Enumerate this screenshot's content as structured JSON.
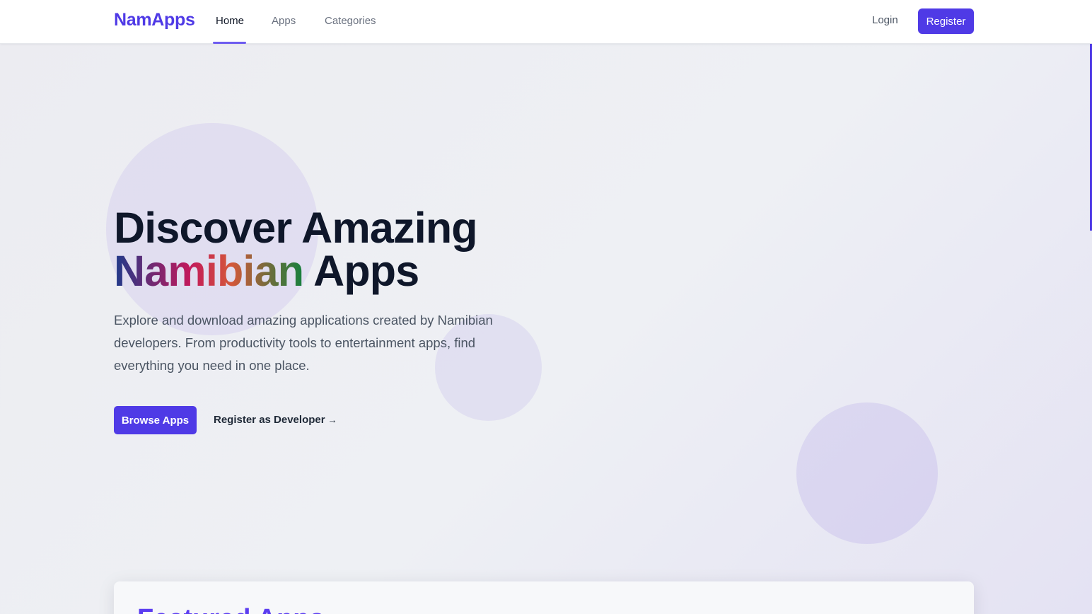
{
  "header": {
    "logo": "NamApps",
    "nav": {
      "home": "Home",
      "apps": "Apps",
      "categories": "Categories"
    },
    "active_nav": "Home",
    "login": "Login",
    "register": "Register"
  },
  "hero": {
    "title_line1": "Discover Amazing",
    "title_highlight": "Namibian",
    "title_rest": "Apps",
    "description": "Explore and download amazing applications created by Namibian developers. From productivity tools to entertainment apps, find everything you need in one place.",
    "browse_button": "Browse Apps",
    "developer_link": "Register as Developer",
    "developer_arrow": "→"
  },
  "featured": {
    "title": "Featured Apps"
  },
  "colors": {
    "brand": "#4f3ae6",
    "text_dark": "#0f172a",
    "text_muted": "#4b5563"
  }
}
